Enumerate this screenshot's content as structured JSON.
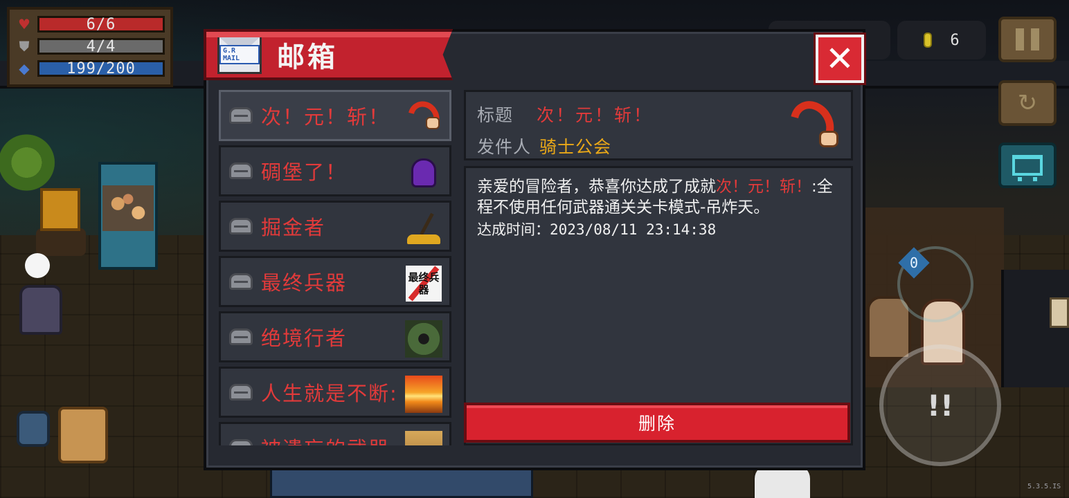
{
  "hud": {
    "hp": "6/6",
    "armor": "4/4",
    "energy": "199/200",
    "coins": "6",
    "version": "5.3.5.IS"
  },
  "icons": {
    "hp": "heart-icon",
    "armor": "shield-icon",
    "energy": "diamond-icon",
    "pause": "pause-icon",
    "refresh": "refresh-icon",
    "shop": "cart-icon",
    "skill": "skill-icon",
    "weapon_badge": "0"
  },
  "mailbox": {
    "title": "邮箱",
    "envelope_stamp": "G.R MAIL",
    "close_label": "✕",
    "items": [
      {
        "label": "次！元！斩！",
        "thumb": "blade-hand"
      },
      {
        "label": "碉堡了！",
        "thumb": "purple-ghost"
      },
      {
        "label": "掘金者",
        "thumb": "shovel-gold"
      },
      {
        "label": "最终兵器",
        "thumb": "final-weapon",
        "thumb_text": "最终兵器"
      },
      {
        "label": "绝境行者",
        "thumb": "dark-forest"
      },
      {
        "label": "人生就是不断:",
        "thumb": "sunset"
      },
      {
        "label": "被遗忘的武器",
        "thumb": "sand"
      }
    ],
    "detail": {
      "title_key": "标题",
      "title_value": "次！元！斩！",
      "sender_key": "发件人",
      "sender_value": "骑士公会",
      "body_prefix": "亲爱的冒险者，恭喜你达成了成就",
      "body_highlight": "次！元！斩！",
      "body_suffix": ":全程不使用任何武器通关关卡模式-吊炸天。",
      "time_label": "达成时间：",
      "time_value": "2023/08/11 23:14:38",
      "delete_label": "删除"
    }
  },
  "colors": {
    "accent_red": "#d8222e",
    "mail_red_text": "#e23a3a",
    "sender_gold": "#eaa818",
    "panel": "#262931"
  }
}
